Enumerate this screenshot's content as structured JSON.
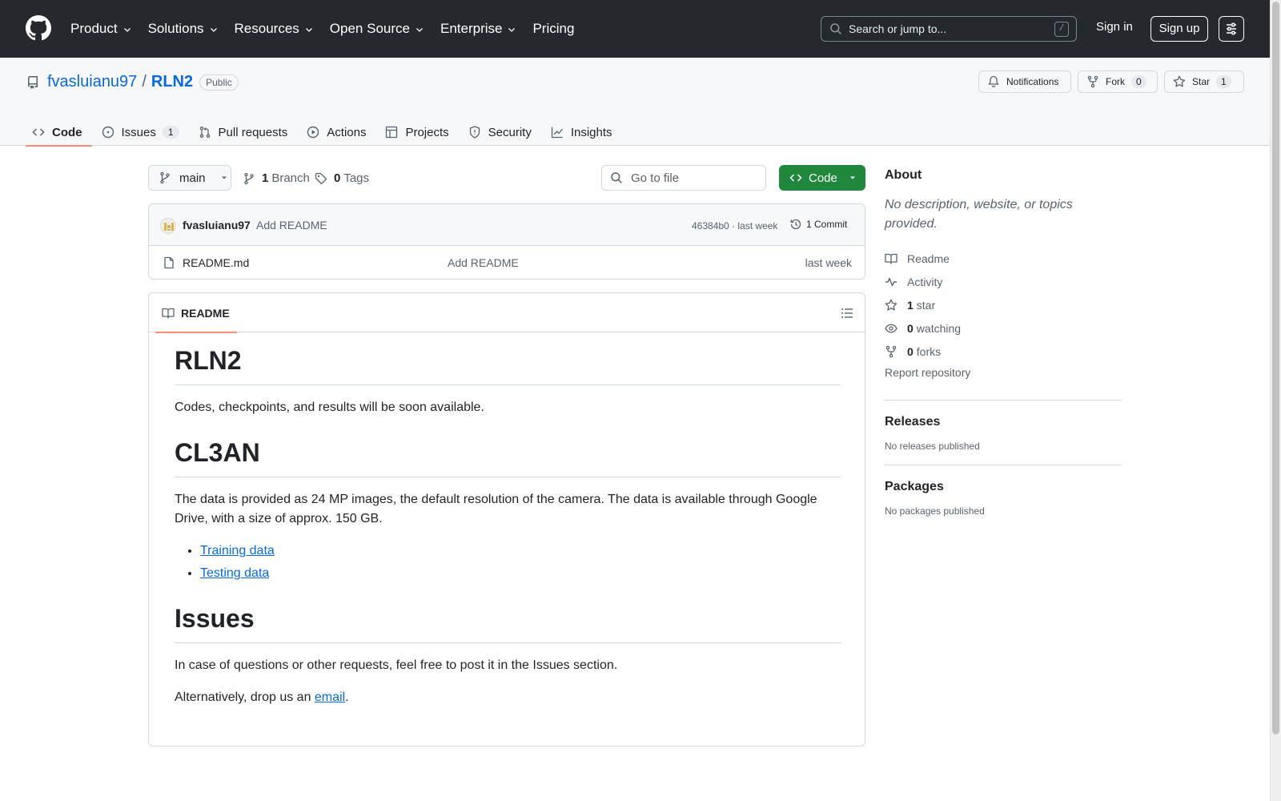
{
  "header": {
    "nav": [
      "Product",
      "Solutions",
      "Resources",
      "Open Source",
      "Enterprise",
      "Pricing"
    ],
    "search_placeholder": "Search or jump to...",
    "search_shortcut": "/",
    "sign_in": "Sign in",
    "sign_up": "Sign up"
  },
  "repo": {
    "owner": "fvasluianu97",
    "separator": "/",
    "name": "RLN2",
    "visibility": "Public",
    "notifications_label": "Notifications",
    "fork_label": "Fork",
    "fork_count": "0",
    "star_label": "Star",
    "star_count": "1"
  },
  "tabs": [
    {
      "label": "Code",
      "icon": "code-icon"
    },
    {
      "label": "Issues",
      "icon": "issue-opened-icon",
      "count": "1"
    },
    {
      "label": "Pull requests",
      "icon": "git-pull-request-icon"
    },
    {
      "label": "Actions",
      "icon": "play-icon"
    },
    {
      "label": "Projects",
      "icon": "table-icon"
    },
    {
      "label": "Security",
      "icon": "shield-icon"
    },
    {
      "label": "Insights",
      "icon": "graph-icon"
    }
  ],
  "filebar": {
    "branch": "main",
    "branches_count": "1",
    "branches_label": "Branch",
    "tags_count": "0",
    "tags_label": "Tags",
    "goto_placeholder": "Go to file",
    "code_button": "Code"
  },
  "commit": {
    "author": "fvasluianu97",
    "message": "Add README",
    "hash": "46384b0",
    "sep": "·",
    "time": "last week",
    "commits_label": "1 Commit"
  },
  "files": [
    {
      "name": "README.md",
      "message": "Add README",
      "date": "last week"
    }
  ],
  "readme": {
    "tab_label": "README",
    "h1_title": "RLN2",
    "p1": "Codes, checkpoints, and results will be soon available.",
    "h1_dataset": "CL3AN",
    "p2": "The data is provided as 24 MP images, the default resolution of the camera. The data is available through Google Drive, with a size of approx. 150 GB.",
    "links": [
      "Training data",
      "Testing data"
    ],
    "h1_issues": "Issues",
    "p3": "In case of questions or other requests, feel free to post it in the Issues section.",
    "p4_before": "Alternatively, drop us an ",
    "p4_link": "email",
    "p4_after": "."
  },
  "sidebar": {
    "about_title": "About",
    "description": "No description, website, or topics provided.",
    "readme": "Readme",
    "activity": "Activity",
    "stars_count": "1",
    "stars_label": "star",
    "watching_count": "0",
    "watching_label": "watching",
    "forks_count": "0",
    "forks_label": "forks",
    "report": "Report repository",
    "releases_title": "Releases",
    "releases_text": "No releases published",
    "packages_title": "Packages",
    "packages_text": "No packages published"
  },
  "colors": {
    "header_bg": "#25292e",
    "link": "#0969da",
    "primary_button": "#1f883d",
    "tab_underline": "#fd8c73"
  }
}
